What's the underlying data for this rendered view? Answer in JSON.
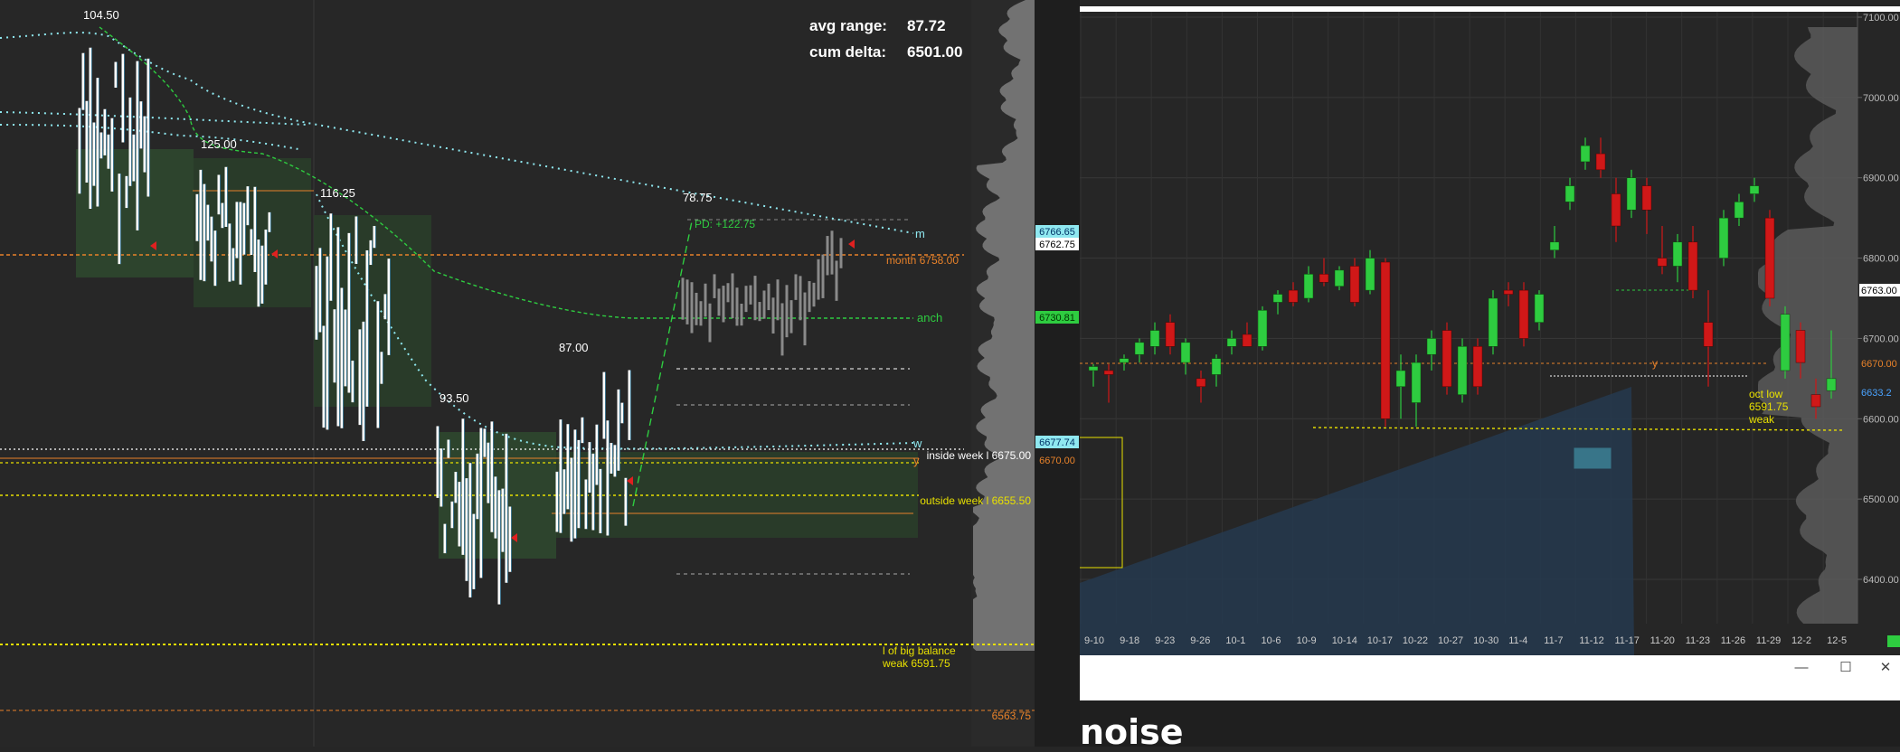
{
  "left_chart": {
    "stats": {
      "avg_range_label": "avg range:",
      "avg_range_value": "87.72",
      "cum_delta_label": "cum delta:",
      "cum_delta_value": "6501.00"
    },
    "swing_labels": [
      "104.50",
      "125.00",
      "116.25",
      "93.50",
      "87.00",
      "78.75"
    ],
    "annotations": {
      "pd": "PD: +122.75",
      "m": "m",
      "anch": "anch",
      "w": "w",
      "y": "y",
      "month": "month  6758.00",
      "inside_week": "inside week l  6675.00",
      "outside_week": "outside week l  6655.50",
      "big_balance_1": "l of big balance",
      "big_balance_2": "weak  6591.75",
      "bottom_price": "6563.75"
    },
    "price_tags": {
      "p1": "6766.65",
      "p2": "6762.75",
      "p3": "6730.81",
      "p4": "6677.74",
      "p5": "6670.00"
    },
    "colors": {
      "cyan_dots": "#8fe8f0",
      "green_dash": "#2ecc40",
      "orange": "#e8822a",
      "yellow": "#e8e000"
    }
  },
  "right_chart": {
    "y_axis": [
      "7100.00",
      "7000.00",
      "6900.00",
      "6800.00",
      "6700.00",
      "6600.00",
      "6500.00",
      "6400.00"
    ],
    "x_axis": [
      "9-10",
      "9-18",
      "9-23",
      "9-26",
      "10-1",
      "10-6",
      "10-9",
      "10-14",
      "10-17",
      "10-22",
      "10-27",
      "10-30",
      "11-4",
      "11-7",
      "11-12",
      "11-17",
      "11-20",
      "11-23",
      "11-26",
      "11-29",
      "12-2",
      "12-5"
    ],
    "price_tags": {
      "t1": "6763.00",
      "t2": "6670.00",
      "t3": "6633.2"
    },
    "annotations": {
      "y": "y",
      "oct_low_1": "oct low",
      "oct_low_2": "6591.75",
      "oct_low_3": "weak"
    },
    "candles": [
      {
        "x": "9-10",
        "o": 6660,
        "h": 6668,
        "l": 6640,
        "c": 6665
      },
      {
        "x": "9-12",
        "o": 6660,
        "h": 6668,
        "l": 6620,
        "c": 6655
      },
      {
        "x": "9-15",
        "o": 6670,
        "h": 6680,
        "l": 6660,
        "c": 6675
      },
      {
        "x": "9-16",
        "o": 6680,
        "h": 6700,
        "l": 6670,
        "c": 6695
      },
      {
        "x": "9-18",
        "o": 6690,
        "h": 6720,
        "l": 6680,
        "c": 6710
      },
      {
        "x": "9-19",
        "o": 6720,
        "h": 6730,
        "l": 6680,
        "c": 6690
      },
      {
        "x": "9-22",
        "o": 6670,
        "h": 6700,
        "l": 6655,
        "c": 6695
      },
      {
        "x": "9-23",
        "o": 6650,
        "h": 6660,
        "l": 6620,
        "c": 6640
      },
      {
        "x": "9-24",
        "o": 6655,
        "h": 6680,
        "l": 6640,
        "c": 6675
      },
      {
        "x": "9-25",
        "o": 6690,
        "h": 6710,
        "l": 6680,
        "c": 6700
      },
      {
        "x": "9-26",
        "o": 6705,
        "h": 6720,
        "l": 6690,
        "c": 6690
      },
      {
        "x": "9-29",
        "o": 6690,
        "h": 6740,
        "l": 6685,
        "c": 6735
      },
      {
        "x": "9-30",
        "o": 6745,
        "h": 6760,
        "l": 6730,
        "c": 6755
      },
      {
        "x": "10-1",
        "o": 6760,
        "h": 6770,
        "l": 6740,
        "c": 6745
      },
      {
        "x": "10-2",
        "o": 6750,
        "h": 6790,
        "l": 6745,
        "c": 6780
      },
      {
        "x": "10-3",
        "o": 6780,
        "h": 6800,
        "l": 6765,
        "c": 6770
      },
      {
        "x": "10-6",
        "o": 6765,
        "h": 6790,
        "l": 6760,
        "c": 6785
      },
      {
        "x": "10-7",
        "o": 6790,
        "h": 6800,
        "l": 6740,
        "c": 6745
      },
      {
        "x": "10-8",
        "o": 6760,
        "h": 6810,
        "l": 6755,
        "c": 6800
      },
      {
        "x": "10-9",
        "o": 6795,
        "h": 6800,
        "l": 6590,
        "c": 6600
      },
      {
        "x": "10-10",
        "o": 6640,
        "h": 6680,
        "l": 6600,
        "c": 6660
      },
      {
        "x": "10-13",
        "o": 6620,
        "h": 6680,
        "l": 6590,
        "c": 6670
      },
      {
        "x": "10-14",
        "o": 6680,
        "h": 6710,
        "l": 6660,
        "c": 6700
      },
      {
        "x": "10-15",
        "o": 6710,
        "h": 6720,
        "l": 6630,
        "c": 6640
      },
      {
        "x": "10-16",
        "o": 6630,
        "h": 6700,
        "l": 6620,
        "c": 6690
      },
      {
        "x": "10-17",
        "o": 6690,
        "h": 6700,
        "l": 6630,
        "c": 6640
      },
      {
        "x": "10-20",
        "o": 6690,
        "h": 6760,
        "l": 6680,
        "c": 6750
      },
      {
        "x": "10-21",
        "o": 6760,
        "h": 6770,
        "l": 6740,
        "c": 6755
      },
      {
        "x": "10-22",
        "o": 6760,
        "h": 6770,
        "l": 6690,
        "c": 6700
      },
      {
        "x": "10-23",
        "o": 6720,
        "h": 6760,
        "l": 6710,
        "c": 6755
      },
      {
        "x": "10-24",
        "o": 6810,
        "h": 6840,
        "l": 6800,
        "c": 6820
      },
      {
        "x": "10-27",
        "o": 6870,
        "h": 6900,
        "l": 6860,
        "c": 6890
      },
      {
        "x": "10-28",
        "o": 6920,
        "h": 6950,
        "l": 6910,
        "c": 6940
      },
      {
        "x": "10-29",
        "o": 6930,
        "h": 6950,
        "l": 6900,
        "c": 6910
      },
      {
        "x": "10-30",
        "o": 6880,
        "h": 6900,
        "l": 6820,
        "c": 6840
      },
      {
        "x": "10-31",
        "o": 6860,
        "h": 6910,
        "l": 6850,
        "c": 6900
      },
      {
        "x": "11-3",
        "o": 6890,
        "h": 6900,
        "l": 6830,
        "c": 6860
      },
      {
        "x": "11-4",
        "o": 6800,
        "h": 6840,
        "l": 6780,
        "c": 6790
      },
      {
        "x": "11-5",
        "o": 6790,
        "h": 6830,
        "l": 6770,
        "c": 6820
      },
      {
        "x": "11-6",
        "o": 6820,
        "h": 6840,
        "l": 6750,
        "c": 6760
      },
      {
        "x": "11-7",
        "o": 6720,
        "h": 6760,
        "l": 6640,
        "c": 6690
      },
      {
        "x": "11-10",
        "o": 6800,
        "h": 6860,
        "l": 6790,
        "c": 6850
      },
      {
        "x": "11-11",
        "o": 6850,
        "h": 6880,
        "l": 6840,
        "c": 6870
      },
      {
        "x": "11-12",
        "o": 6880,
        "h": 6900,
        "l": 6870,
        "c": 6890
      },
      {
        "x": "11-13",
        "o": 6850,
        "h": 6860,
        "l": 6740,
        "c": 6750
      },
      {
        "x": "11-14",
        "o": 6660,
        "h": 6740,
        "l": 6650,
        "c": 6730
      },
      {
        "x": "11-17",
        "o": 6710,
        "h": 6720,
        "l": 6650,
        "c": 6670
      },
      {
        "x": "11-18",
        "o": 6630,
        "h": 6650,
        "l": 6600,
        "c": 6615
      },
      {
        "x": "11-19",
        "o": 6635,
        "h": 6710,
        "l": 6625,
        "c": 6650
      }
    ]
  },
  "window_controls": {
    "minimize": "—",
    "maximize": "☐",
    "close": "✕"
  },
  "bottom_text": "noise"
}
